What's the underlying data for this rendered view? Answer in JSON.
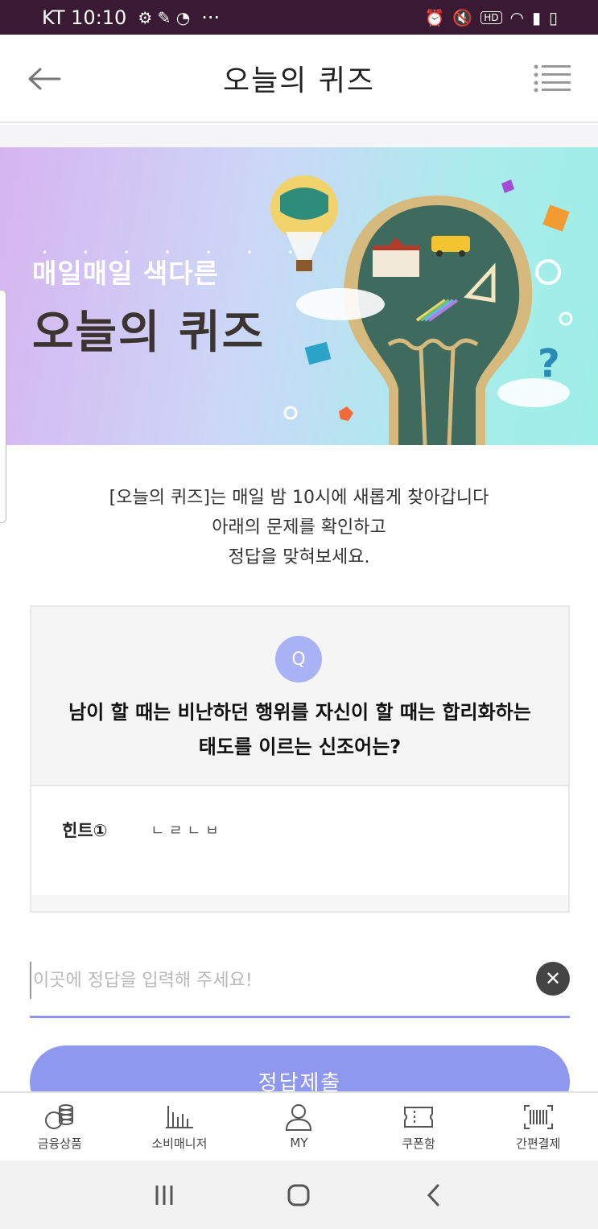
{
  "status": {
    "carrier_time": "KT 10:10",
    "more": "···"
  },
  "header": {
    "title": "오늘의 퀴즈"
  },
  "banner": {
    "subtitle": "매일매일 색다른",
    "title": "오늘의 퀴즈"
  },
  "description": {
    "line1": "[오늘의 퀴즈]는 매일 밤 10시에 새롭게 찾아갑니다",
    "line2": "아래의 문제를 확인하고",
    "line3": "정답을 맞혀보세요."
  },
  "question": {
    "badge": "Q",
    "line1": "남이 할 때는 비난하던 행위를 자신이 할 때는 합리화하는",
    "line2": "태도를 이르는 신조어는?",
    "hint_label": "힌트①",
    "hint_value": "ㄴㄹㄴㅂ"
  },
  "answer": {
    "placeholder": "이곳에 정답을 입력해 주세요!",
    "value": "",
    "clear": "✕"
  },
  "submit": {
    "label": "정답제출"
  },
  "bottom_nav": {
    "items": [
      {
        "label": "금융상품",
        "icon": "coins-icon"
      },
      {
        "label": "소비매니저",
        "icon": "bar-chart-icon"
      },
      {
        "label": "MY",
        "icon": "user-icon"
      },
      {
        "label": "쿠폰함",
        "icon": "ticket-icon"
      },
      {
        "label": "간편결제",
        "icon": "barcode-icon"
      }
    ]
  },
  "colors": {
    "status_bar": "#3a1a33",
    "accent": "#8f98ef",
    "badge": "#a9b2f5",
    "hint_highlight": "#fbd98a"
  }
}
